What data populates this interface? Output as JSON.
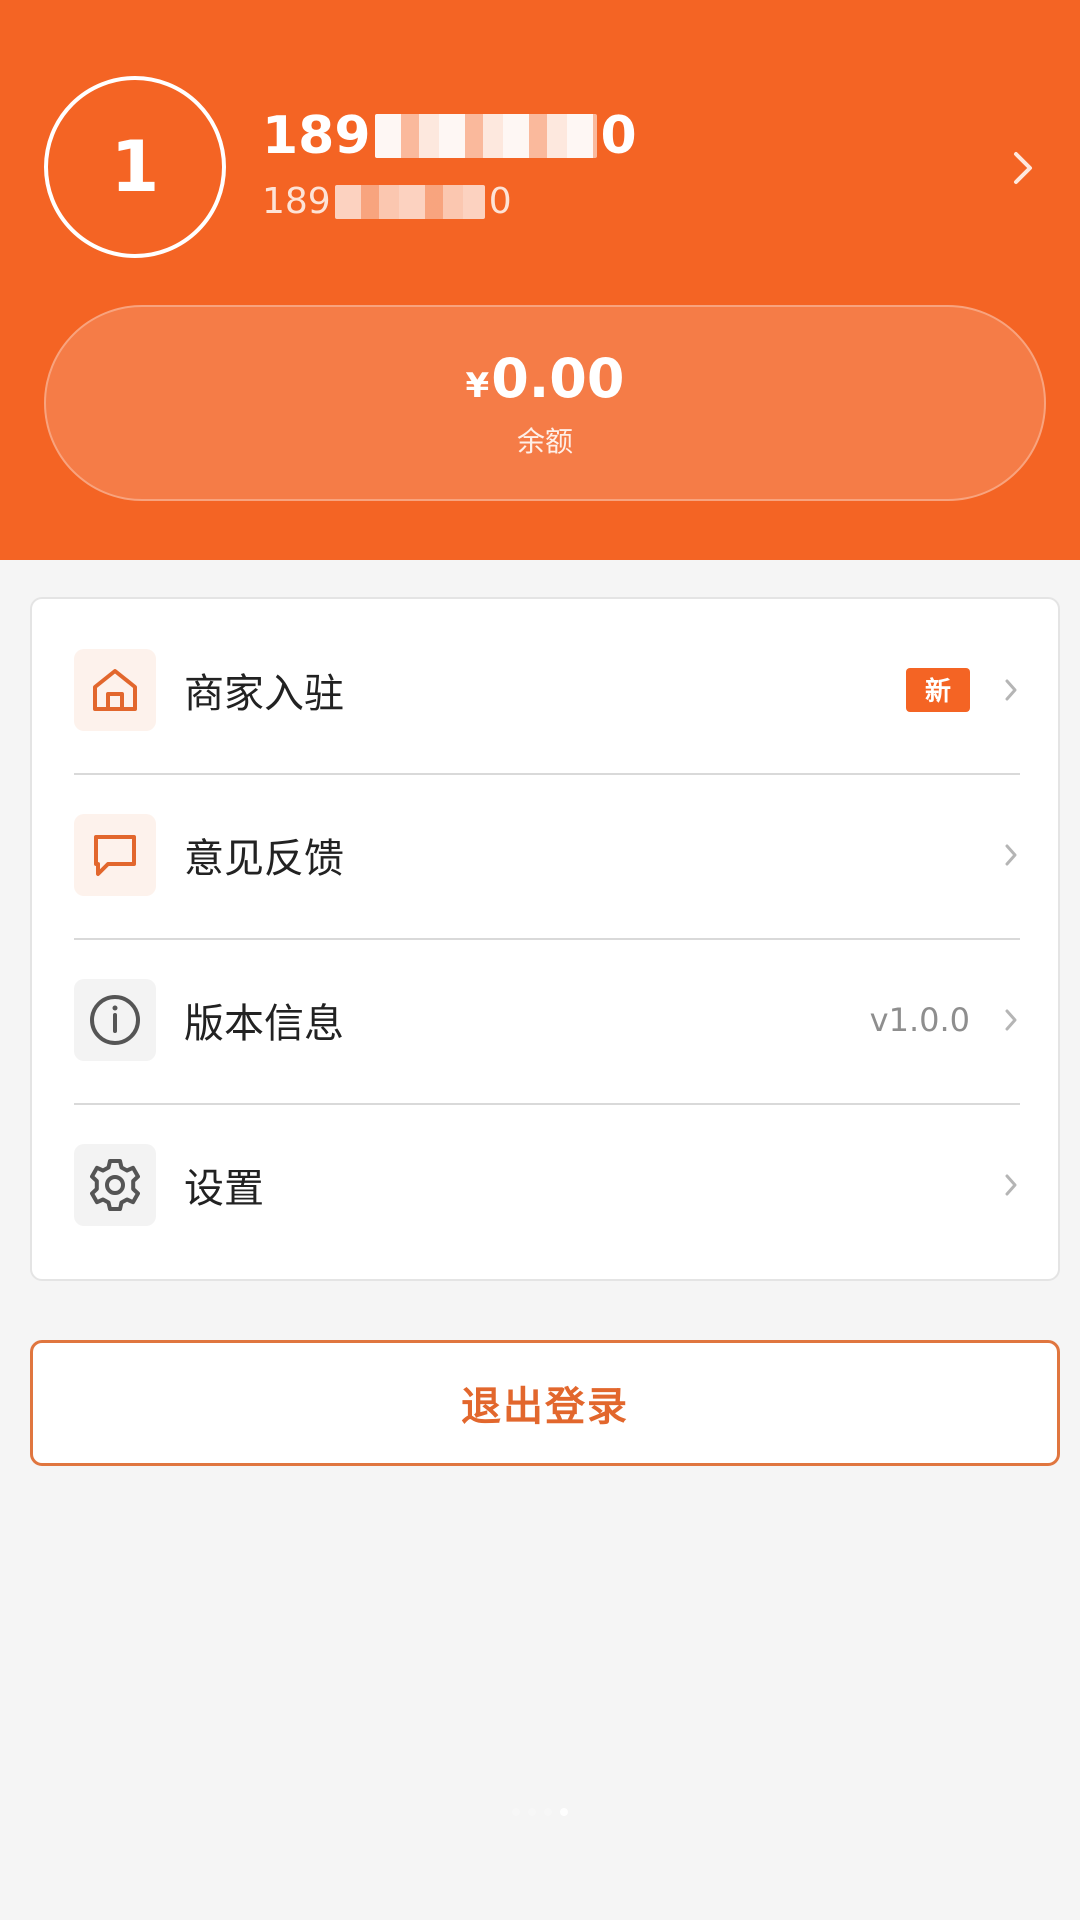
{
  "header": {
    "avatar_text": "1",
    "user_name_start": "189",
    "user_name_end": "0",
    "user_sub_start": "189",
    "user_sub_end": "0",
    "background_color": "#f46424"
  },
  "balance": {
    "currency": "¥",
    "amount": "0.00",
    "label": "余额"
  },
  "menu": {
    "items": [
      {
        "label": "商家入驻",
        "icon": "store-icon",
        "badge": "新"
      },
      {
        "label": "意见反馈",
        "icon": "message-icon"
      },
      {
        "label": "版本信息",
        "icon": "info-icon",
        "value": "v1.0.0"
      },
      {
        "label": "设置",
        "icon": "gear-icon"
      }
    ]
  },
  "logout": {
    "label": "退出登录"
  },
  "colors": {
    "accent": "#f46424",
    "page_background": "#f5f5f5"
  }
}
